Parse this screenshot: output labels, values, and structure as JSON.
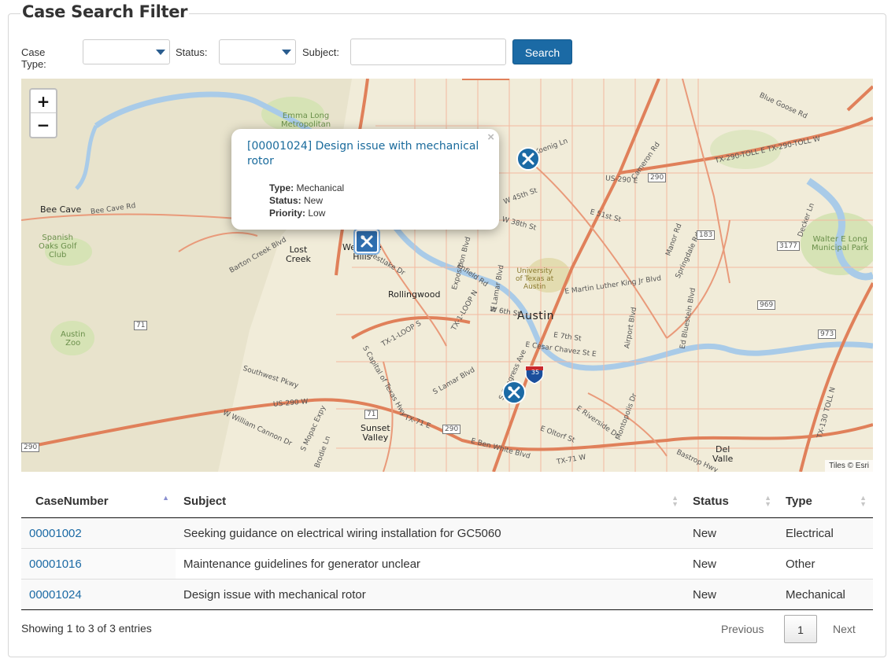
{
  "panel": {
    "title": "Case Search Filter"
  },
  "filters": {
    "case_type_label": "Case Type:",
    "case_type_value": "",
    "status_label": "Status:",
    "status_value": "",
    "subject_label": "Subject:",
    "subject_value": "",
    "search_label": "Search"
  },
  "map": {
    "zoom_in": "+",
    "zoom_out": "−",
    "attribution": "Tiles © Esri",
    "popup": {
      "close": "×",
      "title": "[00001024] Design issue with mechanical rotor",
      "type_label": "Type:",
      "type_value": "Mechanical",
      "status_label": "Status:",
      "status_value": "New",
      "priority_label": "Priority:",
      "priority_value": "Low"
    },
    "places": {
      "austin": "Austin",
      "rollingwood": "Rollingwood",
      "bee_cave": "Bee Cave",
      "lost_creek": "Lost\nCreek",
      "westlake_hills": "Westlake\nHills",
      "sunset_valley": "Sunset\nValley",
      "del_valle": "Del\nValle",
      "austin_zoo": "Austin\nZoo",
      "spanish_oaks": "Spanish\nOaks Golf\nClub",
      "emma_long": "Emma Long\nMetropolitan",
      "walter_long": "Walter E Long\nMunicipal Park",
      "ut_austin": "University\nof Texas at\nAustin"
    },
    "roads": {
      "bee_cave_rd": "Bee Cave Rd",
      "southwest_pkwy": "Southwest Pkwy",
      "us290w": "US-290 W",
      "tx71e": "TX-71 E",
      "ben_white": "E Ben White Blvd",
      "tx1loop": "TX-1-LOOP N",
      "cesar_chavez": "E Cesar Chavez St E",
      "mlk": "E Martin Luther King Jr Blvd",
      "tx290toll": "TX-290-TOLL E TX-290-TOLL W",
      "blue_goose": "Blue Goose Rd",
      "decker": "Decker Ln",
      "bluestein": "Ed Bluestein Blvd",
      "loop360": "TX-1-LOOP S",
      "w45th": "W 45th St",
      "w38th": "W 38th St",
      "e51st": "E 51st St",
      "w6th": "W 6th St",
      "e7th": "E 7th St",
      "s_lamar": "S Lamar Blvd",
      "s_congress": "S Congress Ave",
      "w_william_cannon": "W William Cannon Dr",
      "barton_creek": "Barton Creek Blvd",
      "manor": "Manor Rd",
      "airport": "Airport Blvd",
      "riverside": "E Riverside Dr",
      "montopolis": "Montopolis Dr",
      "springdale": "Springdale Rd",
      "e_oltorf": "E Oltorf St",
      "exposition": "Exposition Blvd",
      "enfield": "Enfield Rd",
      "n_lamar": "N Lamar Blvd",
      "koenig": "W Koenig Ln",
      "cameron": "Cameron Rd",
      "us290e": "US-290 E",
      "bastrop": "Bastrop Hwy",
      "westlake_dr": "Westlake Dr",
      "capital_tx_hwy": "S Capital of Texas Hwy",
      "mopac": "S Mopac Expy",
      "brodie": "Brodie Ln",
      "tx130": "TX-130 TOLL N",
      "tx71w": "TX-71 W"
    },
    "shields": {
      "i35": "35",
      "hwy71a": "71",
      "hwy71b": "71",
      "hwy290a": "290",
      "hwy290b": "290",
      "hwy183": "183",
      "hwy969": "969",
      "hwy973": "973",
      "hwy3177": "3177",
      "hwy290c": "290"
    }
  },
  "table": {
    "headers": [
      "CaseNumber",
      "Subject",
      "Status",
      "Type"
    ],
    "rows": [
      {
        "case_number": "00001002",
        "subject": "Seeking guidance on electrical wiring installation for GC5060",
        "status": "New",
        "type": "Electrical"
      },
      {
        "case_number": "00001016",
        "subject": "Maintenance guidelines for generator unclear",
        "status": "New",
        "type": "Other"
      },
      {
        "case_number": "00001024",
        "subject": "Design issue with mechanical rotor",
        "status": "New",
        "type": "Mechanical"
      }
    ]
  },
  "footer": {
    "info": "Showing 1 to 3 of 3 entries",
    "previous": "Previous",
    "page": "1",
    "next": "Next"
  },
  "colors": {
    "accent": "#1b6aa5",
    "map_land": "#f1ecd9",
    "water": "#a9cbe8",
    "highway": "#e0805a",
    "park": "#d6e3b5"
  },
  "icons": {
    "marker": "tools-icon",
    "select": "chevron-down-icon",
    "sort": "sort-icon"
  }
}
